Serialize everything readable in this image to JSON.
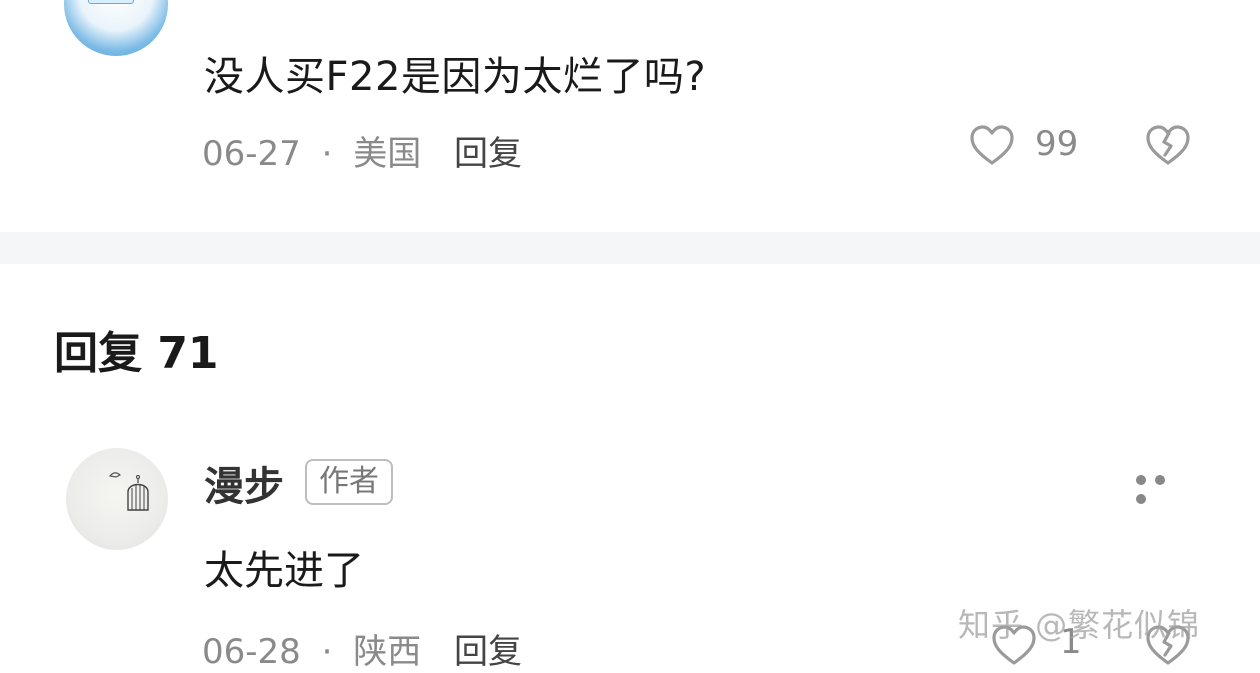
{
  "top_comment": {
    "username_partial": "",
    "text": "没人买F22是因为太烂了吗?",
    "date": "06-27",
    "location": "美国",
    "separator": "·",
    "reply_label": "回复",
    "like_count": "99"
  },
  "replies_section": {
    "title": "回复 71"
  },
  "reply_comment": {
    "username": "漫步",
    "badge": "作者",
    "text": "太先进了",
    "date": "06-28",
    "location": "陕西",
    "separator": "·",
    "reply_label": "回复",
    "like_count": "1"
  },
  "watermark": "知乎 @繁花似锦",
  "colors": {
    "meta_gray": "#8a8a8a",
    "text_dark": "#1a1a1a",
    "divider": "#f5f6f8"
  },
  "icons": {
    "like": "heart-outline-icon",
    "dislike": "broken-heart-icon",
    "more": "more-dots-icon"
  }
}
